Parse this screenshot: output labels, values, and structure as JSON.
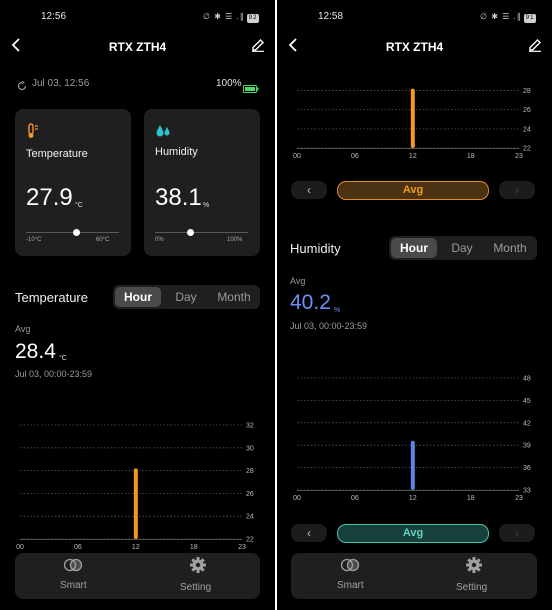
{
  "colors": {
    "temperature_bar": "#f39a1e",
    "humidity_bar": "#5b86e5",
    "humidity_value": "#6f8ff5",
    "temp_icon": "#f2962a",
    "humidity_icon": "#2ec3c9",
    "battery_green": "#4cd964",
    "avg_orange_border": "#e08a2a",
    "avg_orange_bg": "#4a3213",
    "avg_teal_border": "#48c5b0",
    "avg_teal_bg": "#17403a"
  },
  "left": {
    "status_time": "12:56",
    "status_icons": "∅ ✱ ☰ .∥",
    "battery_level": "92",
    "title": "RTX ZTH4",
    "sync_time": "Jul 03, 12:56",
    "battery_percent": "100%",
    "temp_card": {
      "icon": "thermometer-icon",
      "label": "Temperature",
      "value": "27.9",
      "unit": "°C",
      "min_label": "-10°C",
      "max_label": "60°C",
      "level": 0.541
    },
    "humidity_card": {
      "icon": "water-drops-icon",
      "label": "Humidity",
      "value": "38.1",
      "unit": "%",
      "min_label": "0%",
      "max_label": "100%",
      "level": 0.381
    },
    "section_title": "Temperature",
    "tabs": [
      "Hour",
      "Day",
      "Month"
    ],
    "active_tab": "Hour",
    "avg_label": "Avg",
    "avg_value": "28.4",
    "avg_unit": "°C",
    "range_text": "Jul 03, 00:00-23:59",
    "bottom_tabs": [
      {
        "label": "Smart",
        "icon": "smart-icon"
      },
      {
        "label": "Setting",
        "icon": "gear-icon"
      }
    ]
  },
  "right": {
    "status_time": "12:58",
    "status_icons": "∅ ✱ ☰ .∥",
    "battery_level": "91",
    "title": "RTX ZTH4",
    "avg_button": "Avg",
    "section_title": "Humidity",
    "tabs": [
      "Hour",
      "Day",
      "Month"
    ],
    "active_tab": "Hour",
    "avg_label": "Avg",
    "avg_value": "40.2",
    "avg_unit": "%",
    "range_text": "Jul 03, 00:00-23:59",
    "avg_button_2": "Avg",
    "bottom_tabs": [
      {
        "label": "Smart",
        "icon": "smart-icon"
      },
      {
        "label": "Setting",
        "icon": "gear-icon"
      }
    ]
  },
  "chart_data": [
    {
      "type": "bar",
      "x_ticks": [
        "00",
        "06",
        "12",
        "18",
        "23"
      ],
      "y_ticks": [
        "32",
        "30",
        "28",
        "26",
        "24",
        "22"
      ],
      "ylim": [
        22,
        32
      ],
      "xlim": [
        0,
        23
      ],
      "bars": [
        {
          "x": 12,
          "low": 22,
          "high": 28.2
        }
      ],
      "grid": true
    },
    {
      "type": "bar",
      "x_ticks": [
        "00",
        "06",
        "12",
        "18",
        "23"
      ],
      "y_ticks": [
        "28",
        "26",
        "24",
        "22"
      ],
      "ylim": [
        22,
        29
      ],
      "xlim": [
        0,
        23
      ],
      "bars": [
        {
          "x": 12,
          "low": 22,
          "high": 28.2
        }
      ],
      "grid": true
    },
    {
      "type": "bar",
      "x_ticks": [
        "00",
        "06",
        "12",
        "18",
        "23"
      ],
      "y_ticks": [
        "48",
        "45",
        "42",
        "39",
        "36",
        "33"
      ],
      "ylim": [
        33,
        48
      ],
      "xlim": [
        0,
        23
      ],
      "bars": [
        {
          "x": 12,
          "low": 33,
          "high": 39.6
        }
      ],
      "grid": true
    }
  ]
}
